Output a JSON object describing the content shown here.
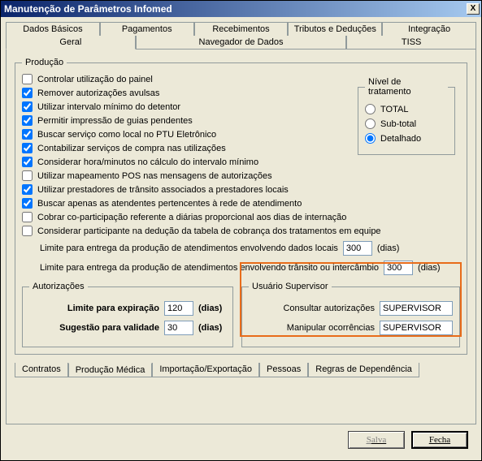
{
  "window": {
    "title": "Manutenção de Parâmetros Infomed",
    "close": "X"
  },
  "tabs_top": {
    "row1": [
      "Dados Básicos",
      "Pagamentos",
      "Recebimentos",
      "Tributos e Deduções",
      "Integração"
    ],
    "row2": [
      "Geral",
      "Navegador de Dados",
      "TISS"
    ],
    "selected": "Geral"
  },
  "producao": {
    "legend": "Produção",
    "checks": [
      {
        "label": "Controlar utilização do painel",
        "checked": false
      },
      {
        "label": "Remover autorizações avulsas",
        "checked": true
      },
      {
        "label": "Utilizar intervalo mínimo do detentor",
        "checked": true
      },
      {
        "label": "Permitir impressão de guias pendentes",
        "checked": true
      },
      {
        "label": "Buscar serviço como local no PTU Eletrônico",
        "checked": true
      },
      {
        "label": "Contabilizar serviços de compra nas utilizações",
        "checked": true
      },
      {
        "label": "Considerar hora/minutos no cálculo do intervalo mínimo",
        "checked": true
      },
      {
        "label": "Utilizar mapeamento POS nas mensagens de autorizações",
        "checked": false
      },
      {
        "label": "Utilizar prestadores de trânsito associados a prestadores locais",
        "checked": true
      },
      {
        "label": "Buscar apenas as atendentes pertencentes à rede de atendimento",
        "checked": true
      },
      {
        "label": "Cobrar co-participação referente a diárias proporcional aos dias de internação",
        "checked": false
      },
      {
        "label": "Considerar participante na dedução da tabela de cobrança dos tratamentos em equipe",
        "checked": false
      }
    ],
    "limit1": {
      "label": "Limite para entrega da produção de atendimentos envolvendo dados locais",
      "value": "300",
      "unit": "(dias)"
    },
    "limit2": {
      "label": "Limite para entrega da produção de atendimentos envolvendo trânsito ou intercâmbio",
      "value": "300",
      "unit": "(dias)"
    }
  },
  "nivel": {
    "legend": "Nível de tratamento",
    "options": [
      {
        "label": "TOTAL",
        "checked": false
      },
      {
        "label": "Sub-total",
        "checked": false
      },
      {
        "label": "Detalhado",
        "checked": true
      }
    ]
  },
  "autorizacoes": {
    "legend": "Autorizações",
    "expira": {
      "label": "Limite para expiração",
      "value": "120",
      "unit": "(dias)"
    },
    "validade": {
      "label": "Sugestão para validade",
      "value": "30",
      "unit": "(dias)"
    }
  },
  "supervisor": {
    "legend": "Usuário Supervisor",
    "consultar": {
      "label": "Consultar autorizações",
      "value": "SUPERVISOR"
    },
    "manipular": {
      "label": "Manipular ocorrências",
      "value": "SUPERVISOR"
    }
  },
  "tabs_bottom": [
    "Contratos",
    "Produção Médica",
    "Importação/Exportação",
    "Pessoas",
    "Regras de Dependência"
  ],
  "tabs_bottom_selected": "Produção Médica",
  "footer": {
    "save": "Salva",
    "close": "Fecha"
  }
}
